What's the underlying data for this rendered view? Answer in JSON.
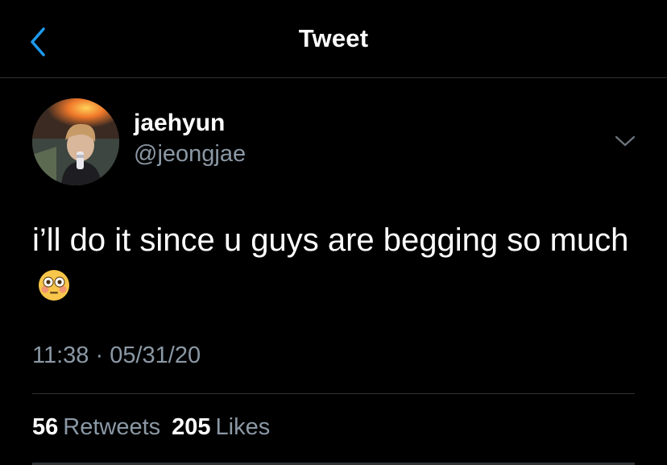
{
  "header": {
    "title": "Tweet",
    "back_icon": "chevron-left-icon"
  },
  "author": {
    "display_name": "jaehyun",
    "handle": "@jeongjae",
    "avatar_icon": "avatar-photo"
  },
  "more_icon": "chevron-down-icon",
  "tweet": {
    "text": "i’ll do it since u guys are begging so much",
    "emoji": "flushed-face-emoji"
  },
  "meta": {
    "time": "11:38",
    "separator": "·",
    "date": "05/31/20"
  },
  "stats": {
    "retweets_count": "56",
    "retweets_label": "Retweets",
    "likes_count": "205",
    "likes_label": "Likes"
  },
  "colors": {
    "background": "#000000",
    "accent": "#1d9bf0",
    "secondary_text": "#8b98a5",
    "divider": "#2f3336"
  }
}
